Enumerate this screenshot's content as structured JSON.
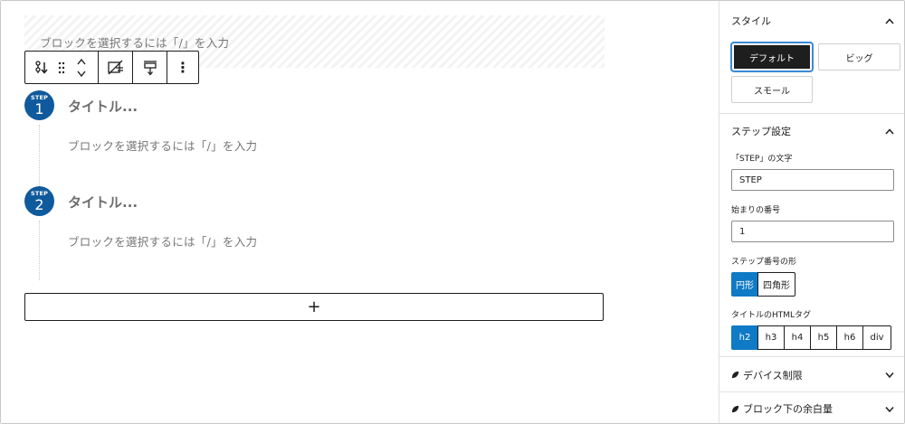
{
  "canvas": {
    "top_placeholder": "ブロックを選択するには「/」を入力",
    "steps": [
      {
        "label": "STEP",
        "number": "1",
        "title": "タイトル...",
        "body": "ブロックを選択するには「/」を入力"
      },
      {
        "label": "STEP",
        "number": "2",
        "title": "タイトル...",
        "body": "ブロックを選択するには「/」を入力"
      }
    ],
    "add_block_label": "+"
  },
  "toolbar": {
    "buttons": [
      "block-type",
      "drag-handle",
      "move-up",
      "move-down",
      "transform",
      "align",
      "more-options"
    ],
    "more_label": "⋮"
  },
  "sidebar": {
    "style_panel": {
      "title": "スタイル",
      "options": [
        {
          "label": "デフォルト",
          "active": true
        },
        {
          "label": "ビッグ",
          "active": false
        },
        {
          "label": "スモール",
          "active": false
        }
      ]
    },
    "step_settings": {
      "title": "ステップ設定",
      "step_text_label": "「STEP」の文字",
      "step_text_value": "STEP",
      "start_number_label": "始まりの番号",
      "start_number_value": "1",
      "shape_label": "ステップ番号の形",
      "shapes": [
        {
          "label": "円形",
          "active": true
        },
        {
          "label": "四角形",
          "active": false
        }
      ],
      "html_tag_label": "タイトルのHTMLタグ",
      "tags": [
        {
          "label": "h2",
          "active": true
        },
        {
          "label": "h3",
          "active": false
        },
        {
          "label": "h4",
          "active": false
        },
        {
          "label": "h5",
          "active": false
        },
        {
          "label": "h6",
          "active": false
        },
        {
          "label": "div",
          "active": false
        }
      ]
    },
    "device_panel": {
      "title": "デバイス制限"
    },
    "margin_panel": {
      "title": "ブロック下の余白量"
    }
  },
  "colors": {
    "accent": "#0f7ac6",
    "step_badge": "#0f5a9c",
    "text": "#1e1e1e",
    "placeholder": "#757575"
  }
}
